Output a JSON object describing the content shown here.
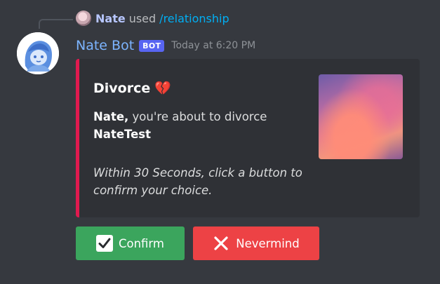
{
  "reply": {
    "user": "Nate",
    "used": "used",
    "command": "/relationship"
  },
  "message": {
    "author": "Nate Bot",
    "tag": "BOT",
    "timestamp": "Today at 6:20 PM"
  },
  "embed": {
    "title": "Divorce",
    "title_emoji": "💔",
    "accent_color": "#e01a4f",
    "desc_user": "Nate,",
    "desc_text": " you're about to divorce",
    "desc_target": "NateTest",
    "note": "Within 30 Seconds, click a button to confirm your choice."
  },
  "buttons": {
    "confirm_label": "Confirm",
    "cancel_label": "Nevermind",
    "confirm_color": "#3ba55d",
    "cancel_color": "#ed4245"
  },
  "icons": {
    "confirm": "check-box-icon",
    "cancel": "cross-mark-icon"
  }
}
